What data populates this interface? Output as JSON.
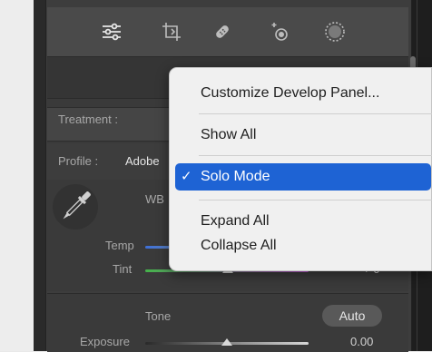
{
  "tools": [
    {
      "name": "edit-sliders-icon"
    },
    {
      "name": "crop-icon"
    },
    {
      "name": "healing-icon"
    },
    {
      "name": "red-eye-icon"
    },
    {
      "name": "masking-icon"
    }
  ],
  "basic": {
    "treatment_label": "Treatment :",
    "profile_label": "Profile :",
    "profile_value": "Adobe",
    "wb_label": "WB",
    "temp_label": "Temp",
    "tint_label": "Tint",
    "tint_value": "+ 0"
  },
  "tone": {
    "title": "Tone",
    "auto_label": "Auto",
    "exposure_label": "Exposure",
    "exposure_value": "0.00"
  },
  "menu": {
    "items": [
      {
        "label": "Customize Develop Panel..."
      },
      {
        "label": "Show All"
      },
      {
        "label": "Solo Mode",
        "checked": true
      },
      {
        "label": "Expand All"
      },
      {
        "label": "Collapse All"
      }
    ],
    "check_mark": "✓"
  },
  "colors": {
    "selection": "#1e63d4",
    "panel": "#3d3d3d"
  }
}
